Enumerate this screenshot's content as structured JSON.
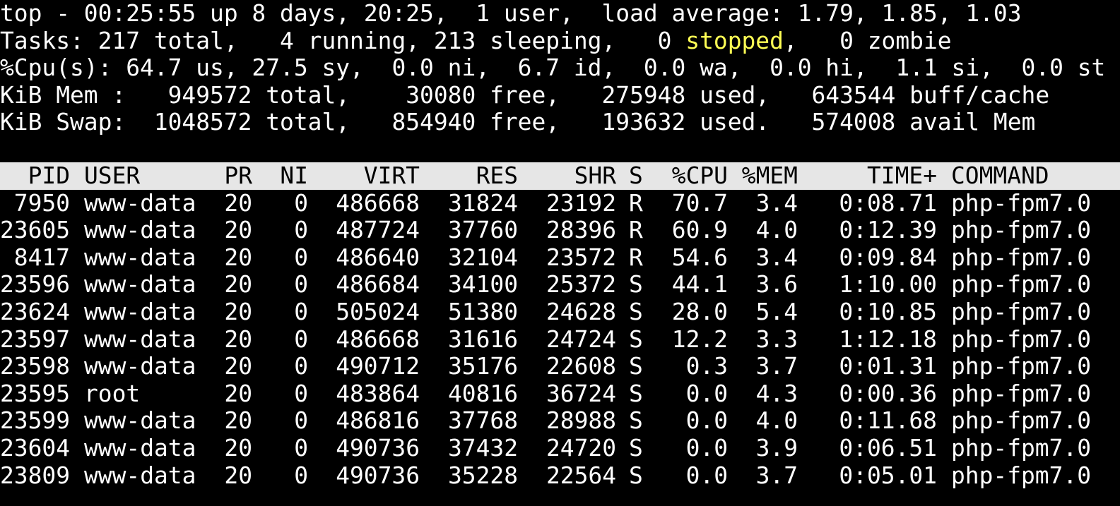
{
  "colors": {
    "background": "#000000",
    "foreground": "#ffffff",
    "header_bg": "#e6e6e6",
    "header_fg": "#000000",
    "highlight_yellow": "#ffff54"
  },
  "summary": {
    "line1": "top - 00:25:55 up 8 days, 20:25,  1 user,  load average: 1.79, 1.85, 1.03",
    "tasks_prefix": "Tasks: 217 total,   4 running, 213 sleeping,   0 ",
    "tasks_stopped": "stopped",
    "tasks_suffix": ",   0 zombie",
    "cpu": "%Cpu(s): 64.7 us, 27.5 sy,  0.0 ni,  6.7 id,  0.0 wa,  0.0 hi,  1.1 si,  0.0 st",
    "mem": "KiB Mem :   949572 total,    30080 free,   275948 used,   643544 buff/cache",
    "swap": "KiB Swap:  1048572 total,   854940 free,   193632 used.   574008 avail Mem"
  },
  "table": {
    "headers": {
      "pid": "PID",
      "user": "USER",
      "pr": "PR",
      "ni": "NI",
      "virt": "VIRT",
      "res": "RES",
      "shr": "SHR",
      "s": "S",
      "cpu": "%CPU",
      "mem": "%MEM",
      "time": "TIME+",
      "command": "COMMAND"
    },
    "rows": [
      {
        "pid": "7950",
        "user": "www-data",
        "pr": "20",
        "ni": "0",
        "virt": "486668",
        "res": "31824",
        "shr": "23192",
        "s": "R",
        "cpu": "70.7",
        "mem": "3.4",
        "time": "0:08.71",
        "command": "php-fpm7.0"
      },
      {
        "pid": "23605",
        "user": "www-data",
        "pr": "20",
        "ni": "0",
        "virt": "487724",
        "res": "37760",
        "shr": "28396",
        "s": "R",
        "cpu": "60.9",
        "mem": "4.0",
        "time": "0:12.39",
        "command": "php-fpm7.0"
      },
      {
        "pid": "8417",
        "user": "www-data",
        "pr": "20",
        "ni": "0",
        "virt": "486640",
        "res": "32104",
        "shr": "23572",
        "s": "R",
        "cpu": "54.6",
        "mem": "3.4",
        "time": "0:09.84",
        "command": "php-fpm7.0"
      },
      {
        "pid": "23596",
        "user": "www-data",
        "pr": "20",
        "ni": "0",
        "virt": "486684",
        "res": "34100",
        "shr": "25372",
        "s": "S",
        "cpu": "44.1",
        "mem": "3.6",
        "time": "1:10.00",
        "command": "php-fpm7.0"
      },
      {
        "pid": "23624",
        "user": "www-data",
        "pr": "20",
        "ni": "0",
        "virt": "505024",
        "res": "51380",
        "shr": "24628",
        "s": "S",
        "cpu": "28.0",
        "mem": "5.4",
        "time": "0:10.85",
        "command": "php-fpm7.0"
      },
      {
        "pid": "23597",
        "user": "www-data",
        "pr": "20",
        "ni": "0",
        "virt": "486668",
        "res": "31616",
        "shr": "24724",
        "s": "S",
        "cpu": "12.2",
        "mem": "3.3",
        "time": "1:12.18",
        "command": "php-fpm7.0"
      },
      {
        "pid": "23598",
        "user": "www-data",
        "pr": "20",
        "ni": "0",
        "virt": "490712",
        "res": "35176",
        "shr": "22608",
        "s": "S",
        "cpu": "0.3",
        "mem": "3.7",
        "time": "0:01.31",
        "command": "php-fpm7.0"
      },
      {
        "pid": "23595",
        "user": "root",
        "pr": "20",
        "ni": "0",
        "virt": "483864",
        "res": "40816",
        "shr": "36724",
        "s": "S",
        "cpu": "0.0",
        "mem": "4.3",
        "time": "0:00.36",
        "command": "php-fpm7.0"
      },
      {
        "pid": "23599",
        "user": "www-data",
        "pr": "20",
        "ni": "0",
        "virt": "486816",
        "res": "37768",
        "shr": "28988",
        "s": "S",
        "cpu": "0.0",
        "mem": "4.0",
        "time": "0:11.68",
        "command": "php-fpm7.0"
      },
      {
        "pid": "23604",
        "user": "www-data",
        "pr": "20",
        "ni": "0",
        "virt": "490736",
        "res": "37432",
        "shr": "24720",
        "s": "S",
        "cpu": "0.0",
        "mem": "3.9",
        "time": "0:06.51",
        "command": "php-fpm7.0"
      },
      {
        "pid": "23809",
        "user": "www-data",
        "pr": "20",
        "ni": "0",
        "virt": "490736",
        "res": "35228",
        "shr": "22564",
        "s": "S",
        "cpu": "0.0",
        "mem": "3.7",
        "time": "0:05.01",
        "command": "php-fpm7.0"
      }
    ]
  }
}
